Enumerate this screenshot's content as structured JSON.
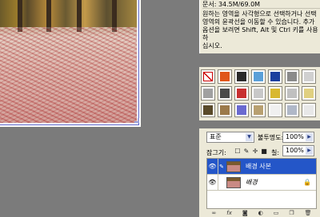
{
  "info": {
    "doc_size": "문서: 34.5M/69.0M",
    "help_text": "원하는 영역을 사각형으로 선택하거나 선택\n영역의 윤곽선을 이동할 수 있습니다. 추가\n옵션을 보려면 Shift, Alt 및 Ctrl 키를 사용하\n십시오."
  },
  "styles": {
    "swatches": [
      {
        "icon": "none-style-icon",
        "color": "#ffffff"
      },
      {
        "icon": "style-swatch-icon",
        "color": "#e0561a"
      },
      {
        "icon": "style-swatch-icon",
        "color": "#2a2a2a"
      },
      {
        "icon": "style-swatch-icon",
        "color": "#5aa0d8"
      },
      {
        "icon": "style-swatch-icon",
        "color": "#1c3f9e"
      },
      {
        "icon": "style-swatch-icon",
        "color": "#8a8a8a"
      },
      {
        "icon": "style-swatch-icon",
        "color": "#d0d0d0"
      },
      {
        "icon": "style-swatch-icon",
        "color": "#a0a0a0"
      },
      {
        "icon": "style-swatch-icon",
        "color": "#4a4a4a"
      },
      {
        "icon": "style-swatch-icon",
        "color": "#c83030"
      },
      {
        "icon": "style-swatch-icon",
        "color": "#c8c8c8"
      },
      {
        "icon": "style-swatch-icon",
        "color": "#d8b830"
      },
      {
        "icon": "style-swatch-icon",
        "color": "#c0c0c0"
      },
      {
        "icon": "style-swatch-icon",
        "color": "#e0d080"
      },
      {
        "icon": "style-swatch-icon",
        "color": "#5a4a2a"
      },
      {
        "icon": "style-swatch-icon",
        "color": "#9c7a4a"
      },
      {
        "icon": "style-swatch-icon",
        "color": "#6a6ad0"
      },
      {
        "icon": "style-swatch-icon",
        "color": "#b8a070"
      },
      {
        "icon": "style-swatch-icon",
        "color": "#f0f0f0"
      },
      {
        "icon": "style-swatch-icon",
        "color": "#b0b8c8"
      },
      {
        "icon": "style-swatch-icon",
        "color": "#e8e8e8"
      }
    ]
  },
  "layers": {
    "blend_mode": "표준",
    "opacity_label": "불투명도:",
    "opacity_value": "100%",
    "lock_label": "잠그기:",
    "fill_label": "칠:",
    "fill_value": "100%",
    "items": [
      {
        "name": "배경 사본",
        "active": true
      },
      {
        "name": "배경",
        "active": false
      }
    ],
    "bottom_icons": [
      "link-icon",
      "fx-icon",
      "mask-icon",
      "adjustment-icon",
      "group-icon",
      "new-layer-icon",
      "trash-icon"
    ]
  }
}
